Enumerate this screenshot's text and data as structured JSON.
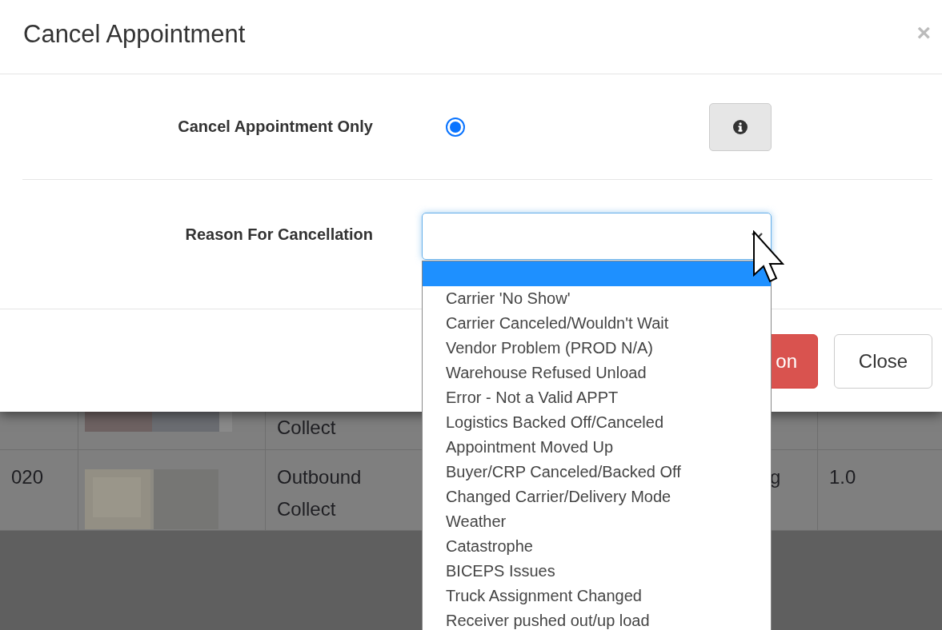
{
  "modal": {
    "title": "Cancel Appointment",
    "close": "×",
    "option": {
      "label": "Cancel Appointment Only",
      "selected": true
    },
    "reason": {
      "label": "Reason For Cancellation",
      "expanded": true,
      "options": [
        {
          "selected": true
        },
        {
          "label": "Carrier 'No Show'",
          "selected": false
        },
        {
          "label": "Carrier Canceled/Wouldn't Wait",
          "selected": false
        },
        {
          "label": "Vendor Problem (PROD N/A)",
          "selected": false
        },
        {
          "label": "Warehouse Refused Unload",
          "selected": false
        },
        {
          "label": "Error - Not a Valid APPT",
          "selected": false
        },
        {
          "label": "Logistics Backed Off/Canceled",
          "selected": false
        },
        {
          "label": "Appointment Moved Up",
          "selected": false
        },
        {
          "label": "Buyer/CRP Canceled/Backed Off",
          "selected": false
        },
        {
          "label": "Changed Carrier/Delivery Mode",
          "selected": false
        },
        {
          "label": "Weather",
          "selected": false
        },
        {
          "label": "Catastrophe",
          "selected": false
        },
        {
          "label": "BICEPS Issues",
          "selected": false
        },
        {
          "label": "Truck Assignment Changed",
          "selected": false
        },
        {
          "label": "Receiver pushed out/up load",
          "selected": false
        }
      ]
    },
    "buttons": [
      {
        "label": "on",
        "kind": "danger"
      },
      {
        "label": "Close",
        "kind": "default"
      }
    ]
  },
  "background_table": {
    "rows": [
      {
        "column_3": "Collect"
      },
      {
        "column_1": "020",
        "column_3": "Outbound Collect",
        "column_4": "g",
        "column_5": "1.0"
      }
    ]
  }
}
